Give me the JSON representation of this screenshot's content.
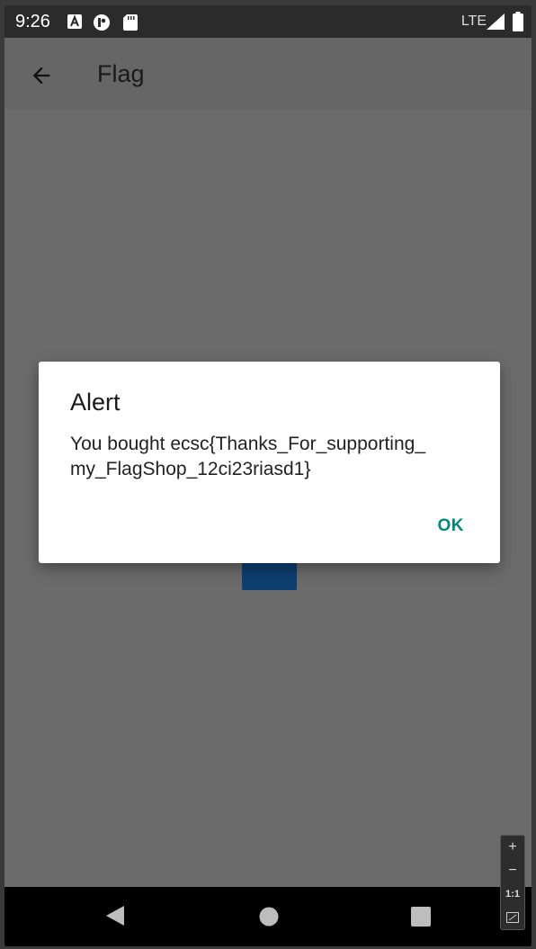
{
  "status_bar": {
    "time": "9:26",
    "network": "LTE",
    "icons": [
      "a-notification-icon",
      "circle-app-icon",
      "sd-card-icon",
      "signal-icon",
      "battery-icon"
    ]
  },
  "app_bar": {
    "title": "Flag",
    "back_icon": "arrow-back-icon"
  },
  "dialog": {
    "title": "Alert",
    "message": "You bought ecsc{Thanks_For_supporting_\nmy_FlagShop_12ci23riasd1}",
    "ok_label": "OK"
  },
  "nav_bar": {
    "icons": [
      "back-triangle-icon",
      "home-circle-icon",
      "recents-square-icon"
    ]
  },
  "zoom_controls": {
    "zoom_in": "+",
    "zoom_out": "−",
    "ratio": "1:1",
    "fit_icon": "fit-screen-icon"
  },
  "colors": {
    "accent": "#00897b",
    "scrim": "#6b6b6b",
    "button_under_scrim": "#0d3f70"
  }
}
